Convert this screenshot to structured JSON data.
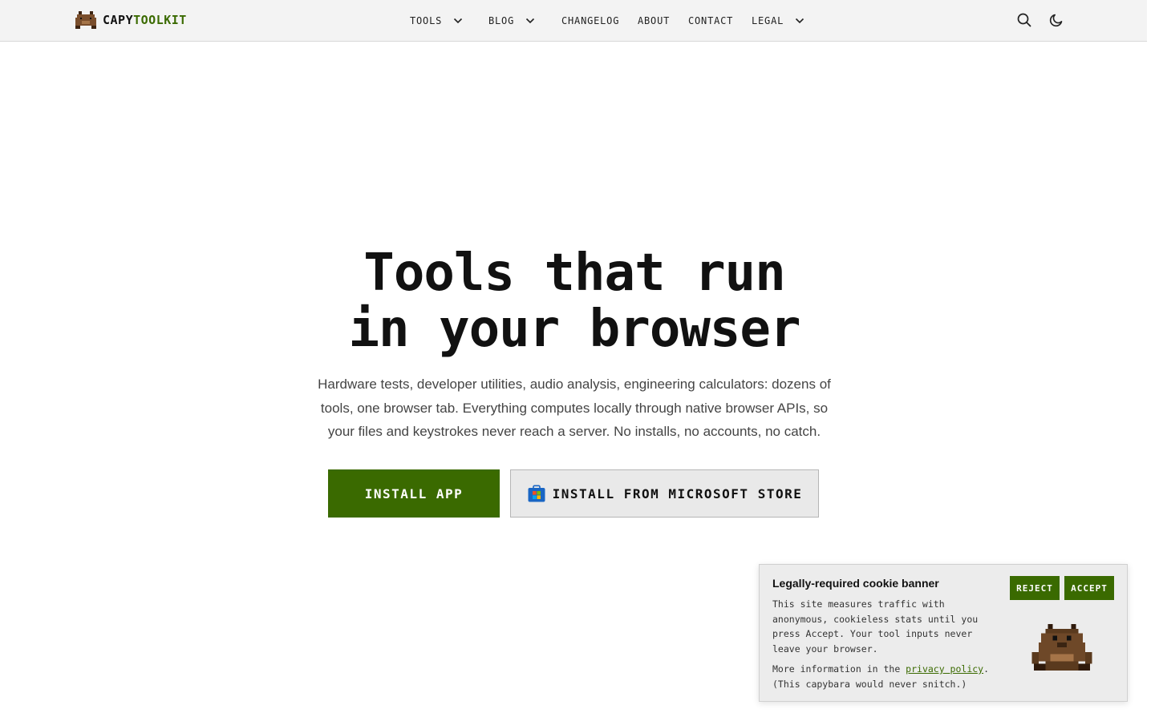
{
  "header": {
    "logo": {
      "part_a": "CAPY",
      "part_b": "TOOLKIT",
      "icon": "capybara-icon"
    },
    "nav": [
      {
        "label": "TOOLS",
        "dropdown": true
      },
      {
        "label": "BLOG",
        "dropdown": true
      },
      {
        "label": "CHANGELOG",
        "dropdown": false
      },
      {
        "label": "ABOUT",
        "dropdown": false
      },
      {
        "label": "CONTACT",
        "dropdown": false
      },
      {
        "label": "LEGAL",
        "dropdown": true
      }
    ],
    "icons": [
      "search-icon",
      "moon-icon"
    ]
  },
  "hero": {
    "title_line1": "Tools that run",
    "title_line2": "in your browser",
    "subtitle": "Hardware tests, developer utilities, audio analysis, engineering calculators: dozens of tools, one browser tab. Everything computes locally through native browser APIs, so your files and keystrokes never reach a server. No installs, no accounts, no catch.",
    "primary_button": "INSTALL APP",
    "secondary_button": "INSTALL FROM MICROSOFT STORE",
    "secondary_icon": "microsoft-store-icon"
  },
  "cookie": {
    "title": "Legally-required cookie banner",
    "body": "This site measures traffic with anonymous, cookieless stats until you press Accept. Your tool inputs never leave your browser.",
    "more_prefix": "More information in the ",
    "link_text": "privacy policy",
    "more_suffix": ". (This capybara would never snitch.)",
    "reject_label": "REJECT",
    "accept_label": "ACCEPT",
    "mascot_icon": "capybara-mascot-icon"
  },
  "colors": {
    "accent": "#3a6a00",
    "header_bg": "#f3f3f3",
    "banner_bg": "#ececec",
    "text": "#111111"
  }
}
